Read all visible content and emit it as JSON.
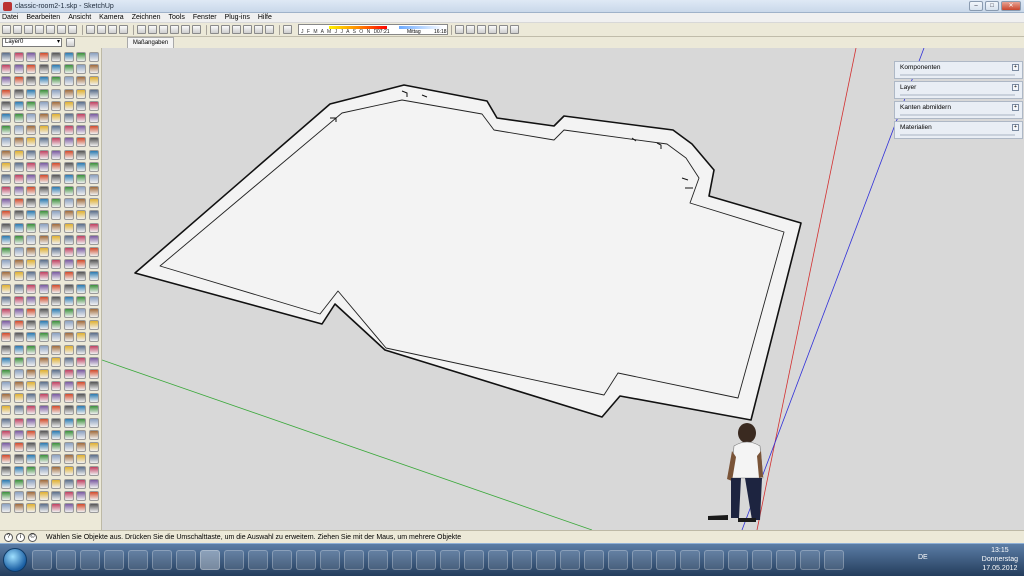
{
  "window": {
    "title": "classic-room2-1.skp - SketchUp"
  },
  "window_controls": {
    "minimize": "–",
    "maximize": "□",
    "close": "✕"
  },
  "menu": [
    "Datei",
    "Bearbeiten",
    "Ansicht",
    "Kamera",
    "Zeichnen",
    "Tools",
    "Fenster",
    "Plug-ins",
    "Hilfe"
  ],
  "shadow_settings": {
    "months": "J F M A M J J A S O N D",
    "time_start": "07:21",
    "noon": "Mittag",
    "time_end": "16:18"
  },
  "layer": {
    "current": "Layer0"
  },
  "measurement_tab": "Maßangaben",
  "trays": [
    {
      "label": "Komponenten",
      "btn": "+"
    },
    {
      "label": "Layer",
      "btn": "+"
    },
    {
      "label": "Kanten abmildern",
      "btn": "+"
    },
    {
      "label": "Materialien",
      "btn": "+"
    }
  ],
  "status": {
    "text": "Wählen Sie Objekte aus. Drücken Sie die Umschalttaste, um die Auswahl zu erweitern. Ziehen Sie mit der Maus, um mehrere Objekte"
  },
  "taskbar": {
    "language": "DE",
    "time": "13:15",
    "weekday": "Donnerstag",
    "date": "17.05.2012"
  },
  "icons": {
    "palette_colors": [
      "#5a6e8a",
      "#d24a2a",
      "#3a8f3a",
      "#e0b030",
      "#7a5aa0",
      "#2a7ab0",
      "#a06a3a",
      "#c04060",
      "#555555",
      "#8aa0c0"
    ]
  }
}
